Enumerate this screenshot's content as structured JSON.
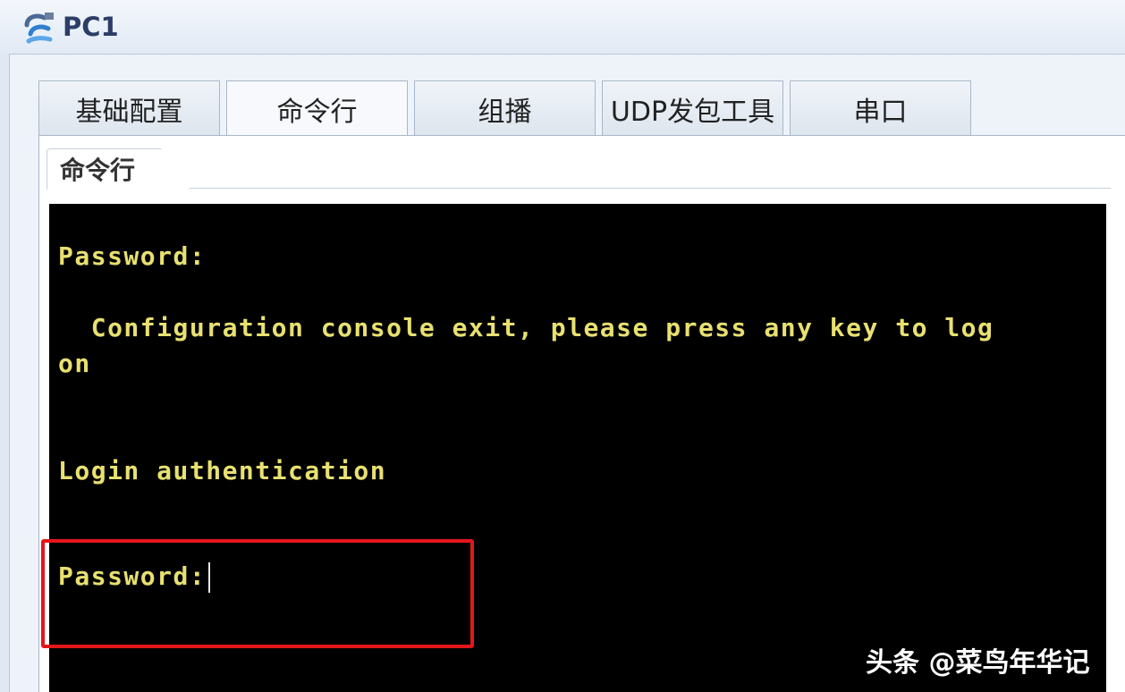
{
  "window": {
    "title": "PC1",
    "app_icon": "network-pc-icon"
  },
  "tabs": [
    {
      "label": "基础配置",
      "active": false
    },
    {
      "label": "命令行",
      "active": true
    },
    {
      "label": "组播",
      "active": false
    },
    {
      "label": "UDP发包工具",
      "active": false
    },
    {
      "label": "串口",
      "active": false
    }
  ],
  "subtab": {
    "label": "命令行"
  },
  "terminal": {
    "lines": [
      "Password:",
      "  Configuration console exit, please press any key to log",
      "on",
      "Login authentication",
      "Password:"
    ],
    "text_color": "#e8e070",
    "background_color": "#000000"
  },
  "annotation": {
    "highlight_color": "#e3161c"
  },
  "watermark": {
    "text": "头条 @菜鸟年华记"
  }
}
